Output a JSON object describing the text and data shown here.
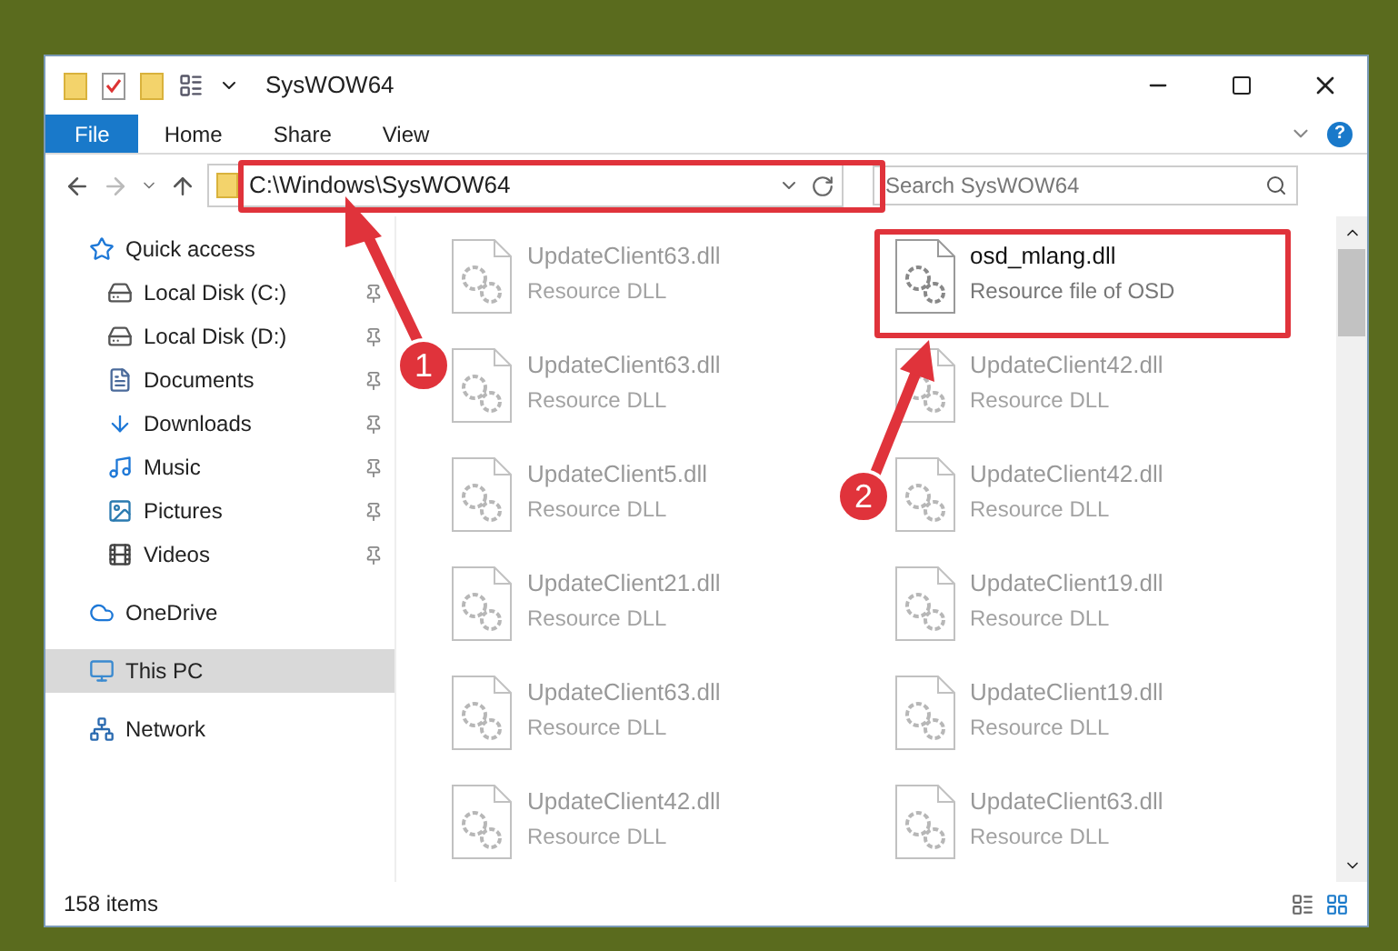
{
  "window": {
    "title": "SysWOW64"
  },
  "ribbon_tabs": [
    {
      "label": "File",
      "selected": true
    },
    {
      "label": "Home",
      "selected": false
    },
    {
      "label": "Share",
      "selected": false
    },
    {
      "label": "View",
      "selected": false
    }
  ],
  "help": {
    "label": "?"
  },
  "address": {
    "value": "C:\\Windows\\SysWOW64"
  },
  "search": {
    "placeholder": "Search SysWOW64"
  },
  "sidebar": {
    "items": [
      {
        "label": "Quick access",
        "kind": "star",
        "pinned": false,
        "selected": false
      },
      {
        "label": "Local Disk (C:)",
        "kind": "disk",
        "pinned": true,
        "selected": false
      },
      {
        "label": "Local Disk (D:)",
        "kind": "disk",
        "pinned": true,
        "selected": false
      },
      {
        "label": "Documents",
        "kind": "documents",
        "pinned": true,
        "selected": false
      },
      {
        "label": "Downloads",
        "kind": "downloads",
        "pinned": true,
        "selected": false
      },
      {
        "label": "Music",
        "kind": "music",
        "pinned": true,
        "selected": false
      },
      {
        "label": "Pictures",
        "kind": "pictures",
        "pinned": true,
        "selected": false
      },
      {
        "label": "Videos",
        "kind": "videos",
        "pinned": true,
        "selected": false
      },
      {
        "label": "OneDrive",
        "kind": "cloud",
        "pinned": false,
        "selected": false
      },
      {
        "label": "This PC",
        "kind": "pc",
        "pinned": false,
        "selected": true
      },
      {
        "label": "Network",
        "kind": "network",
        "pinned": false,
        "selected": false
      }
    ]
  },
  "files": [
    {
      "name": "UpdateClient63.dll",
      "type": "Resource DLL",
      "blurred": true
    },
    {
      "name": "osd_mlang.dll",
      "type": "Resource file of OSD",
      "blurred": false
    },
    {
      "name": "UpdateClient63.dll",
      "type": "Resource DLL",
      "blurred": true
    },
    {
      "name": "UpdateClient42.dll",
      "type": "Resource DLL",
      "blurred": true
    },
    {
      "name": "UpdateClient5.dll",
      "type": "Resource DLL",
      "blurred": true
    },
    {
      "name": "UpdateClient42.dll",
      "type": "Resource DLL",
      "blurred": true
    },
    {
      "name": "UpdateClient21.dll",
      "type": "Resource DLL",
      "blurred": true
    },
    {
      "name": "UpdateClient19.dll",
      "type": "Resource DLL",
      "blurred": true
    },
    {
      "name": "UpdateClient63.dll",
      "type": "Resource DLL",
      "blurred": true
    },
    {
      "name": "UpdateClient19.dll",
      "type": "Resource DLL",
      "blurred": true
    },
    {
      "name": "UpdateClient42.dll",
      "type": "Resource DLL",
      "blurred": true
    },
    {
      "name": "UpdateClient63.dll",
      "type": "Resource DLL",
      "blurred": true
    }
  ],
  "status_bar": {
    "count": "158 items"
  },
  "annotations": [
    {
      "label": "1"
    },
    {
      "label": "2"
    }
  ]
}
